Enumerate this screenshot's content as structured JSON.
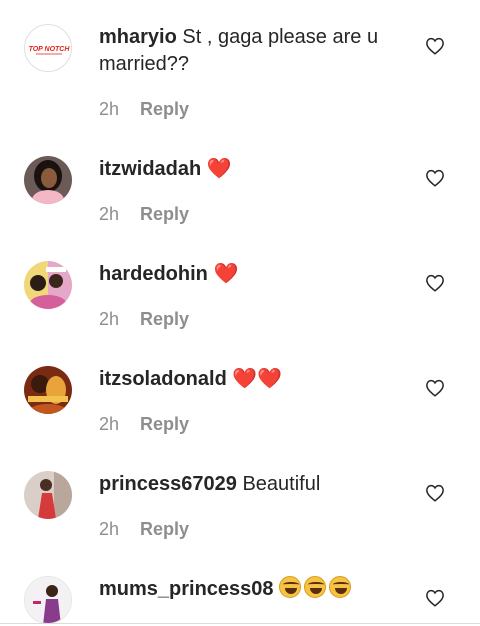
{
  "comments": [
    {
      "username": "mharyio",
      "text": "St , gaga please are u married??",
      "time": "2h",
      "reply": "Reply",
      "avatar": "topnotch-logo",
      "logo_text": "TOP NOTCH"
    },
    {
      "username": "itzwidadah",
      "text": "❤️",
      "time": "2h",
      "reply": "Reply",
      "avatar": "photo"
    },
    {
      "username": "hardedohin",
      "text": "❤️",
      "time": "2h",
      "reply": "Reply",
      "avatar": "photo"
    },
    {
      "username": "itzsoladonald",
      "text": "❤️❤️",
      "time": "2h",
      "reply": "Reply",
      "avatar": "photo"
    },
    {
      "username": "princess67029",
      "text": "Beautiful",
      "time": "2h",
      "reply": "Reply",
      "avatar": "photo"
    },
    {
      "username": "mums_princess08",
      "text": "🤣🤣🤣",
      "time": "",
      "reply": "",
      "avatar": "photo"
    }
  ],
  "icons": {
    "like": "heart-outline-icon"
  },
  "colors": {
    "text": "#262626",
    "meta": "#8e8e8e",
    "heart_emoji": "#d91c2c"
  }
}
